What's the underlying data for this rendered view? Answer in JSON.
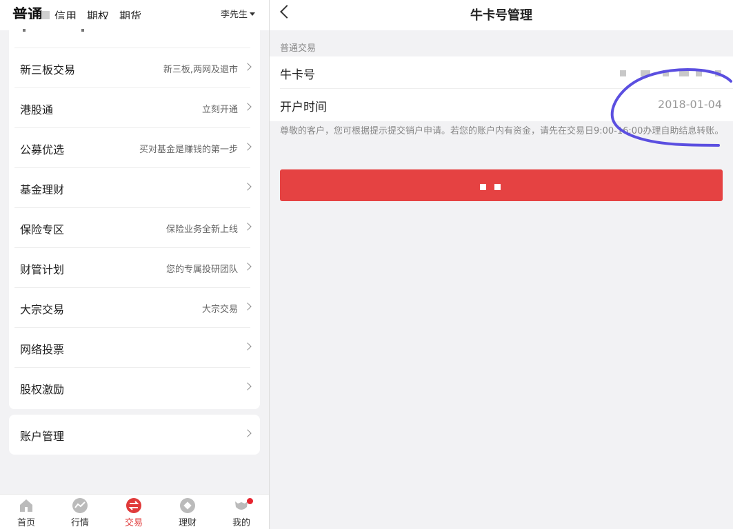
{
  "left_panel": {
    "top_tabs": {
      "main": "普通",
      "tabs": [
        "信用",
        "期权",
        "期货"
      ],
      "user": "李先生"
    },
    "menu": [
      {
        "label": "新三板交易",
        "desc": "新三板,两网及退市"
      },
      {
        "label": "港股通",
        "desc": "立刻开通"
      },
      {
        "label": "公募优选",
        "desc": "买对基金是赚钱的第一步"
      },
      {
        "label": "基金理财",
        "desc": ""
      },
      {
        "label": "保险专区",
        "desc": "保险业务全新上线"
      },
      {
        "label": "财管计划",
        "desc": "您的专属投研团队"
      },
      {
        "label": "大宗交易",
        "desc": "大宗交易"
      },
      {
        "label": "网络投票",
        "desc": ""
      },
      {
        "label": "股权激励",
        "desc": ""
      }
    ],
    "account": {
      "label": "账户管理"
    },
    "bottom_nav": [
      {
        "label": "首页",
        "icon": "home-icon"
      },
      {
        "label": "行情",
        "icon": "market-icon"
      },
      {
        "label": "交易",
        "icon": "trade-icon",
        "active": true
      },
      {
        "label": "理财",
        "icon": "wealth-icon"
      },
      {
        "label": "我的",
        "icon": "profile-icon",
        "badge": true
      }
    ]
  },
  "right_panel": {
    "title": "牛卡号管理",
    "section_title": "普通交易",
    "card_number_label": "牛卡号",
    "open_time_label": "开户时间",
    "open_time_value": "2018-01-04",
    "notice": "尊敬的客户，您可根据提示提交销户申请。若您的账户内有资金，请先在交易日9:00-16:00办理自助结息转账。"
  },
  "colors": {
    "accent_red": "#e54242",
    "active_tab_red": "#e03a3a",
    "scribble_blue": "#5b4fe0",
    "background_gray": "#f2f2f4"
  }
}
